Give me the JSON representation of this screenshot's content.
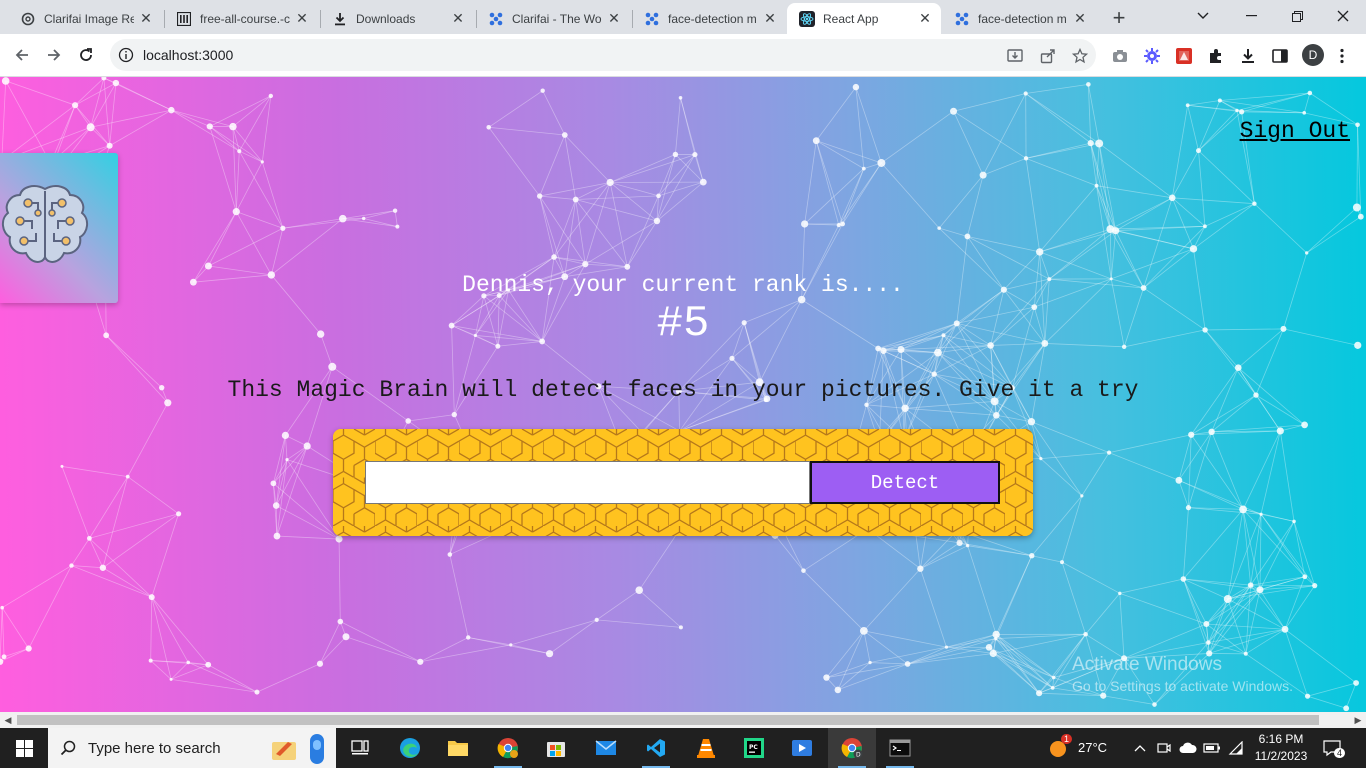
{
  "browser": {
    "tabs": [
      {
        "title": "Clarifai Image Re",
        "icon": "openai-icon",
        "active": false
      },
      {
        "title": "free-all-course.-c",
        "icon": "library-icon",
        "active": false
      },
      {
        "title": "Downloads",
        "icon": "download-icon",
        "active": false
      },
      {
        "title": "Clarifai - The Wo",
        "icon": "clarifai-icon",
        "active": false
      },
      {
        "title": "face-detection m",
        "icon": "clarifai-icon",
        "active": false
      },
      {
        "title": "React App",
        "icon": "react-icon",
        "active": true
      },
      {
        "title": "face-detection m",
        "icon": "clarifai-icon",
        "active": false
      }
    ],
    "url": "localhost:3000",
    "profile_initial": "D"
  },
  "page": {
    "sign_out": "Sign Out",
    "rank_message": "Dennis, your current rank is....",
    "rank_number": "#5",
    "intro_text": "This Magic Brain will detect faces in your pictures. Give it a try",
    "image_url_input": {
      "value": "",
      "placeholder": ""
    },
    "detect_button": "Detect",
    "watermark_line1": "Activate Windows",
    "watermark_line2": "Go to Settings to activate Windows."
  },
  "taskbar": {
    "search_placeholder": "Type here to search",
    "weather_temp": "27°C",
    "weather_badge": "1",
    "time": "6:16 PM",
    "date": "11/2/2023",
    "notification_count": "4"
  },
  "colors": {
    "gradient_start": "#ff5edf",
    "gradient_end": "#04c8de",
    "detect_button": "#9d5ef3",
    "form_background": "#ffc31f"
  }
}
